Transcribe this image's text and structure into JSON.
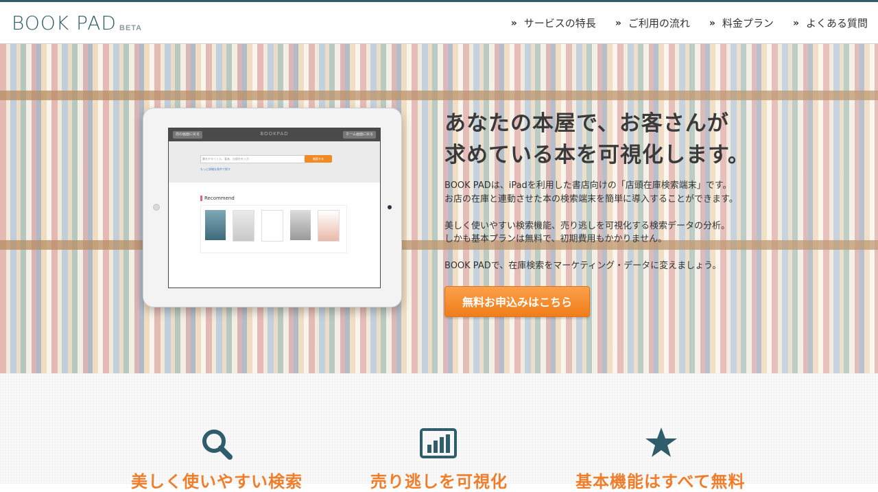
{
  "header": {
    "logo": "BOOK PAD",
    "badge": "BETA",
    "nav": [
      {
        "label": "サービスの特長"
      },
      {
        "label": "ご利用の流れ"
      },
      {
        "label": "料金プラン"
      },
      {
        "label": "よくある質問"
      }
    ]
  },
  "hero": {
    "headline_line1": "あなたの本屋で、お客さんが",
    "headline_line2": "求めている本を可視化します。",
    "paragraph1_line1": "BOOK PADは、iPadを利用した書店向けの「店頭在庫検索端末」です。",
    "paragraph1_line2": "お店の在庫と連動させた本の検索端末を簡単に導入することができます。",
    "paragraph2_line1": "美しく使いやすい検索機能、売り逃しを可視化する検索データの分析。",
    "paragraph2_line2": "しかも基本プランは無料で、初期費用もかかりません。",
    "paragraph3": "BOOK PADで、在庫検索をマーケティング・データに変えましょう。",
    "cta_label": "無料お申込みはこちら",
    "device_screen": {
      "title": "BOOKPAD",
      "left_button": "前の画面に戻る",
      "right_button": "ホーム画面に戻る",
      "search_placeholder": "書名やタイトル、著者、出版社を入力",
      "search_button": "検索する",
      "advanced_link": "もっと詳細な条件で探す",
      "recommend_label": "Recommend"
    }
  },
  "features": [
    {
      "title": "美しく使いやすい検索",
      "icon": "search-icon"
    },
    {
      "title": "売り逃しを可視化",
      "icon": "bar-chart-icon"
    },
    {
      "title": "基本機能はすべて無料",
      "icon": "star-icon"
    }
  ],
  "colors": {
    "brand": "#2f5d6b",
    "accent": "#f07d2a",
    "cta": "#f08a24"
  }
}
